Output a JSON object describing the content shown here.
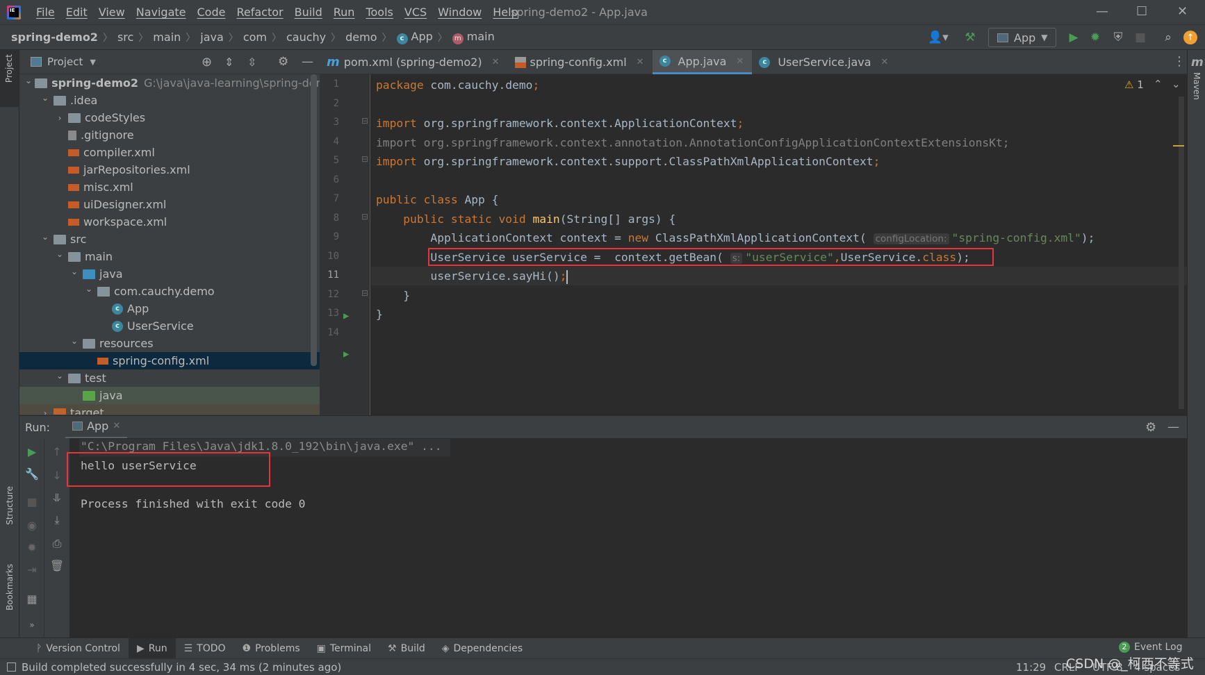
{
  "app": {
    "title": "spring-demo2 - App.java",
    "logo_text": "IE"
  },
  "menu": [
    "File",
    "Edit",
    "View",
    "Navigate",
    "Code",
    "Refactor",
    "Build",
    "Run",
    "Tools",
    "VCS",
    "Window",
    "Help"
  ],
  "window_controls": {
    "minimize": "—",
    "maximize": "☐",
    "close": "✕"
  },
  "breadcrumb": [
    {
      "label": "spring-demo2",
      "icon": "none"
    },
    {
      "label": "src",
      "icon": "none"
    },
    {
      "label": "main",
      "icon": "none"
    },
    {
      "label": "java",
      "icon": "none"
    },
    {
      "label": "com",
      "icon": "none"
    },
    {
      "label": "cauchy",
      "icon": "none"
    },
    {
      "label": "demo",
      "icon": "none"
    },
    {
      "label": "App",
      "icon": "class-icon"
    },
    {
      "label": "main",
      "icon": "method-icon"
    }
  ],
  "toolbar": {
    "run_config": "App",
    "update_badge": "↑"
  },
  "project_panel": {
    "title": "Project"
  },
  "left_strip": {
    "project": "Project",
    "structure": "Structure",
    "bookmarks": "Bookmarks"
  },
  "right_strip": {
    "maven": "Maven",
    "maven_icon": "m"
  },
  "tree": [
    {
      "label": "spring-demo2",
      "path": "G:\\java\\java-learning\\spring-demc",
      "level": 0,
      "chevron": "open",
      "icon": "module-folder",
      "bold": true
    },
    {
      "label": ".idea",
      "level": 1,
      "chevron": "open",
      "icon": "folder"
    },
    {
      "label": "codeStyles",
      "level": 2,
      "chevron": "closed",
      "icon": "folder"
    },
    {
      "label": ".gitignore",
      "level": 2,
      "chevron": "none",
      "icon": "ignored-file"
    },
    {
      "label": "compiler.xml",
      "level": 2,
      "chevron": "none",
      "icon": "xml-file"
    },
    {
      "label": "jarRepositories.xml",
      "level": 2,
      "chevron": "none",
      "icon": "xml-file"
    },
    {
      "label": "misc.xml",
      "level": 2,
      "chevron": "none",
      "icon": "xml-file"
    },
    {
      "label": "uiDesigner.xml",
      "level": 2,
      "chevron": "none",
      "icon": "xml-file"
    },
    {
      "label": "workspace.xml",
      "level": 2,
      "chevron": "none",
      "icon": "xml-file"
    },
    {
      "label": "src",
      "level": 1,
      "chevron": "open",
      "icon": "folder"
    },
    {
      "label": "main",
      "level": 2,
      "chevron": "open",
      "icon": "folder"
    },
    {
      "label": "java",
      "level": 3,
      "chevron": "open",
      "icon": "source-folder"
    },
    {
      "label": "com.cauchy.demo",
      "level": 4,
      "chevron": "open",
      "icon": "package"
    },
    {
      "label": "App",
      "level": 5,
      "chevron": "none",
      "icon": "class"
    },
    {
      "label": "UserService",
      "level": 5,
      "chevron": "none",
      "icon": "class"
    },
    {
      "label": "resources",
      "level": 3,
      "chevron": "open",
      "icon": "resources-folder"
    },
    {
      "label": "spring-config.xml",
      "level": 4,
      "chevron": "none",
      "icon": "xml-file",
      "selected": true
    },
    {
      "label": "test",
      "level": 2,
      "chevron": "open",
      "icon": "folder"
    },
    {
      "label": "java",
      "level": 3,
      "chevron": "none",
      "icon": "test-folder",
      "state": "test"
    },
    {
      "label": "target",
      "level": 1,
      "chevron": "closed",
      "icon": "excluded-folder",
      "state": "target"
    }
  ],
  "tabs": [
    {
      "label": "pom.xml (spring-demo2)",
      "icon": "maven"
    },
    {
      "label": "spring-config.xml",
      "icon": "xml"
    },
    {
      "label": "App.java",
      "icon": "class",
      "active": true
    },
    {
      "label": "UserService.java",
      "icon": "class"
    }
  ],
  "editor": {
    "warnings": "1",
    "current_line": 11,
    "lines": [
      [
        [
          "k",
          "package "
        ],
        [
          "",
          "com.cauchy.demo"
        ],
        [
          "k",
          ";"
        ]
      ],
      [],
      [
        [
          "k",
          "import "
        ],
        [
          "",
          "org.springframework.context.ApplicationContext"
        ],
        [
          "k",
          ";"
        ]
      ],
      [
        [
          "g",
          "import org.springframework.context.annotation.AnnotationConfigApplicationContextExtensionsKt;"
        ]
      ],
      [
        [
          "k",
          "import "
        ],
        [
          "",
          "org.springframework.context.support.ClassPathXmlApplicationContext"
        ],
        [
          "k",
          ";"
        ]
      ],
      [],
      [
        [
          "k",
          "public class "
        ],
        [
          "",
          "App {"
        ]
      ],
      [
        [
          "",
          "    "
        ],
        [
          "k",
          "public static void "
        ],
        [
          "f",
          "main"
        ],
        [
          "",
          "(String[] args) {"
        ]
      ],
      [
        [
          "",
          "        ApplicationContext context = "
        ],
        [
          "k",
          "new "
        ],
        [
          "",
          "ClassPathXmlApplicationContext( "
        ],
        [
          "h",
          "configLocation:"
        ],
        [
          "s",
          "\"spring-config.xml\""
        ],
        [
          "",
          ");"
        ]
      ],
      [
        [
          "",
          "        UserService userService =  context.getBean( "
        ],
        [
          "h",
          "s:"
        ],
        [
          "s",
          "\"userService\""
        ],
        [
          "k",
          ","
        ],
        [
          "",
          "UserService."
        ],
        [
          "k",
          "class"
        ],
        [
          "",
          ");"
        ]
      ],
      [
        [
          "",
          "        userService.sayHi()"
        ],
        [
          "k",
          ";"
        ]
      ],
      [
        [
          "",
          "    }"
        ]
      ],
      [
        [
          "",
          "}"
        ]
      ],
      []
    ]
  },
  "run_panel": {
    "label": "Run:",
    "tab": "App",
    "console": [
      "\"C:\\Program Files\\Java\\jdk1.8.0_192\\bin\\java.exe\" ...",
      "hello userService",
      "",
      "Process finished with exit code 0"
    ]
  },
  "bottom_tabs": [
    {
      "label": "Version Control",
      "icon": "vcs-icon",
      "glyph": "ᚹ"
    },
    {
      "label": "Run",
      "icon": "run-icon",
      "glyph": "▶",
      "active": true
    },
    {
      "label": "TODO",
      "icon": "todo-icon",
      "glyph": "☰"
    },
    {
      "label": "Problems",
      "icon": "problems-icon",
      "glyph": "❶"
    },
    {
      "label": "Terminal",
      "icon": "terminal-icon",
      "glyph": "▣"
    },
    {
      "label": "Build",
      "icon": "build-icon",
      "glyph": "⚒"
    },
    {
      "label": "Dependencies",
      "icon": "dependencies-icon",
      "glyph": "◈"
    }
  ],
  "event_log": {
    "label": "Event Log",
    "count": "2"
  },
  "status": {
    "message": "Build completed successfully in 4 sec, 34 ms (2 minutes ago)",
    "position": "11:29",
    "line_sep": "CRLF",
    "encoding": "UTF-8",
    "indent": "4 spaces",
    "watermark": "CSDN @_柯西不等式"
  },
  "colors": {
    "highlight_box": "#e8343a",
    "accent": "#4a88c7",
    "keyword": "#cc7832",
    "string": "#6a8759",
    "run_green": "#499c54"
  }
}
